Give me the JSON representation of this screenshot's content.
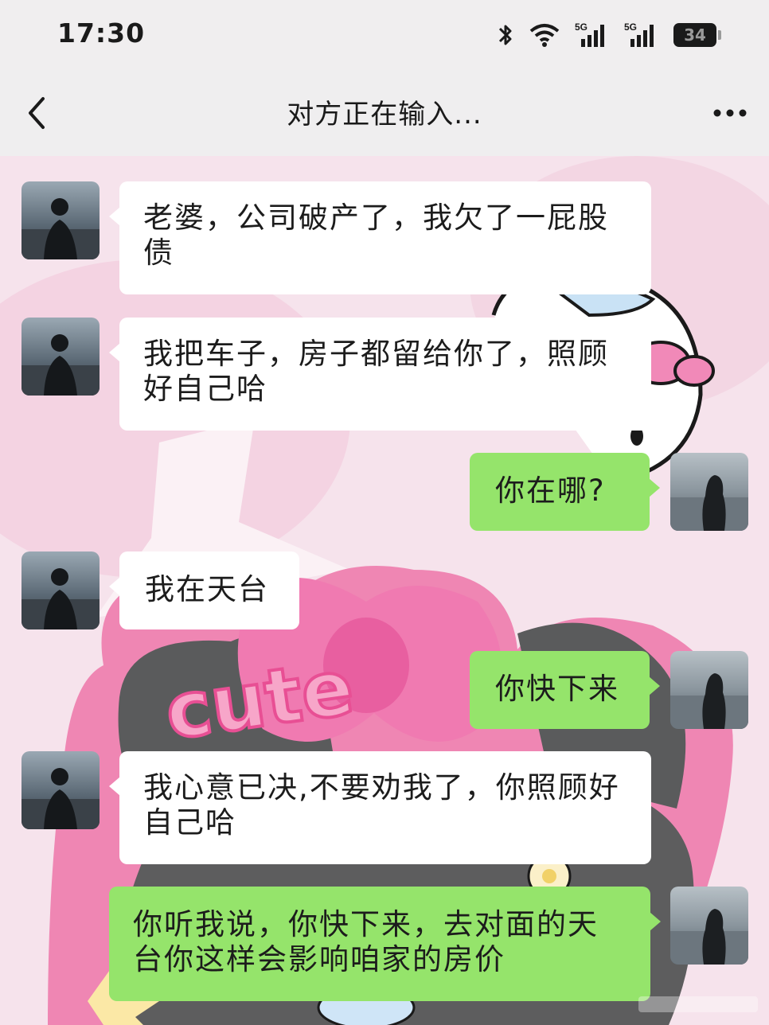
{
  "status_bar": {
    "time": "17:30",
    "battery": "34",
    "signal_1_label": "5G",
    "signal_2_label": "5G",
    "icons": [
      "bluetooth-icon",
      "wifi-icon",
      "signal-icon",
      "signal-icon",
      "battery-icon"
    ]
  },
  "nav": {
    "title": "对方正在输入...",
    "back_icon": "chevron-left-icon",
    "more_icon": "more-dots-icon"
  },
  "wallpaper": {
    "decor_text": "cute"
  },
  "messages": [
    {
      "side": "left",
      "text": "老婆，公司破产了，我欠了一屁股债"
    },
    {
      "side": "left",
      "text": "我把车子，房子都留给你了，照顾好自己哈"
    },
    {
      "side": "right",
      "text": "你在哪?"
    },
    {
      "side": "left",
      "text": "我在天台"
    },
    {
      "side": "right",
      "text": "你快下来"
    },
    {
      "side": "left",
      "text": "我心意已决,不要劝我了，你照顾好自己哈"
    },
    {
      "side": "right",
      "text": "你听我说，你快下来，去对面的天台你这样会影响咱家的房价"
    }
  ],
  "colors": {
    "outgoing_bubble": "#95e46b",
    "incoming_bubble": "#ffffff",
    "wallpaper_pink": "#f08cb8"
  }
}
